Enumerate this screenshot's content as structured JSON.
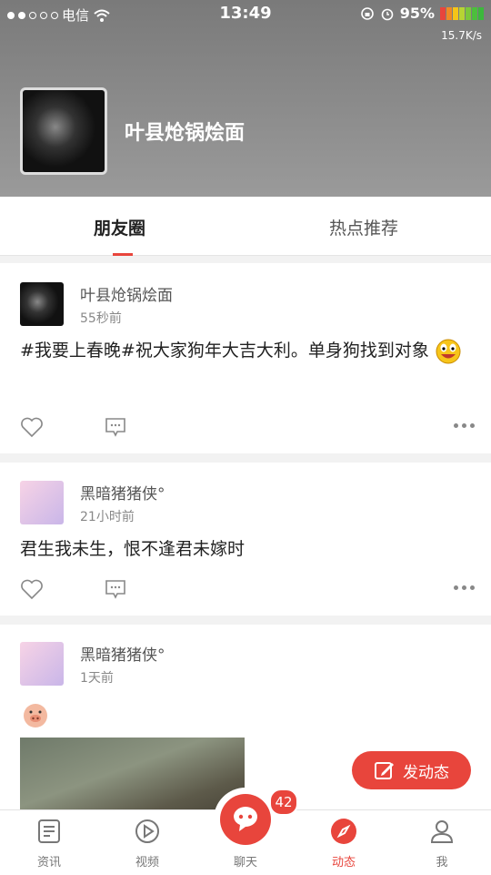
{
  "status_bar": {
    "carrier": "电信",
    "time": "13:49",
    "battery": "95%",
    "net_speed": "15.7K/s"
  },
  "profile": {
    "name": "叶县炝锅烩面"
  },
  "tabs": [
    {
      "label": "朋友圈"
    },
    {
      "label": "热点推荐"
    }
  ],
  "posts": [
    {
      "author": "叶县炝锅烩面",
      "time": "55秒前",
      "text": "#我要上春晚#祝大家狗年大吉大利。单身狗找到对象"
    },
    {
      "author": "黑暗猪猪侠°",
      "time": "21小时前",
      "text": "君生我未生，恨不逢君未嫁时"
    },
    {
      "author": "黑暗猪猪侠°",
      "time": "1天前"
    }
  ],
  "fab_label": "发动态",
  "chat_badge": "42",
  "bottom_nav": [
    {
      "label": "资讯"
    },
    {
      "label": "视频"
    },
    {
      "label": "聊天"
    },
    {
      "label": "动态"
    },
    {
      "label": "我"
    }
  ],
  "colors": {
    "accent": "#e8453c"
  }
}
